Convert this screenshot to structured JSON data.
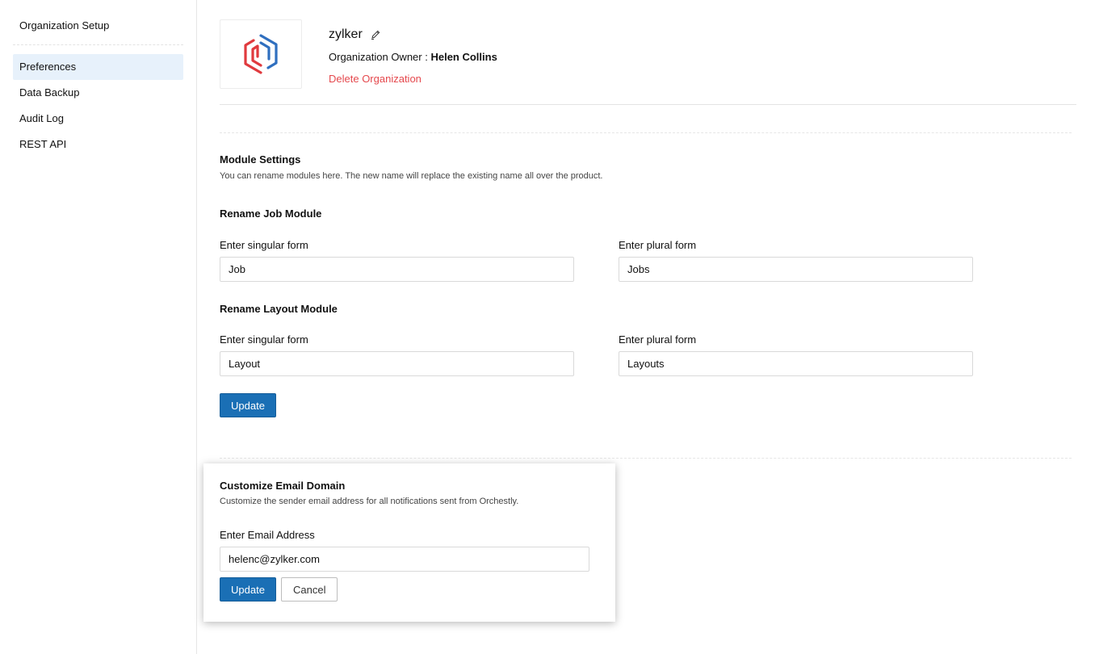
{
  "sidebar": {
    "heading": "Organization Setup",
    "items": [
      {
        "label": "Preferences",
        "active": true
      },
      {
        "label": "Data Backup",
        "active": false
      },
      {
        "label": "Audit Log",
        "active": false
      },
      {
        "label": "REST API",
        "active": false
      }
    ]
  },
  "org": {
    "name": "zylker",
    "owner_label": "Organization Owner :",
    "owner_name": "Helen Collins",
    "delete_label": "Delete Organization"
  },
  "module_settings": {
    "title": "Module Settings",
    "description": "You can rename modules here. The new name will replace the existing name all over the product.",
    "job": {
      "title": "Rename Job Module",
      "singular_label": "Enter singular form",
      "singular_value": "Job",
      "plural_label": "Enter plural form",
      "plural_value": "Jobs"
    },
    "layout": {
      "title": "Rename Layout Module",
      "singular_label": "Enter singular form",
      "singular_value": "Layout",
      "plural_label": "Enter plural form",
      "plural_value": "Layouts"
    },
    "update_label": "Update"
  },
  "email_domain": {
    "title": "Customize Email Domain",
    "description": "Customize the sender email address for all notifications sent from Orchestly.",
    "field_label": "Enter Email Address",
    "email_value": "helenc@zylker.com",
    "update_label": "Update",
    "cancel_label": "Cancel"
  },
  "colors": {
    "primary": "#1a6fb5",
    "danger": "#e5484d",
    "active_bg": "#e7f1fb",
    "logo_blue": "#2f6fbf",
    "logo_red": "#e03a3e"
  },
  "icons": {
    "edit": "pencil-icon",
    "logo": "zylker-hexagon-logo"
  }
}
